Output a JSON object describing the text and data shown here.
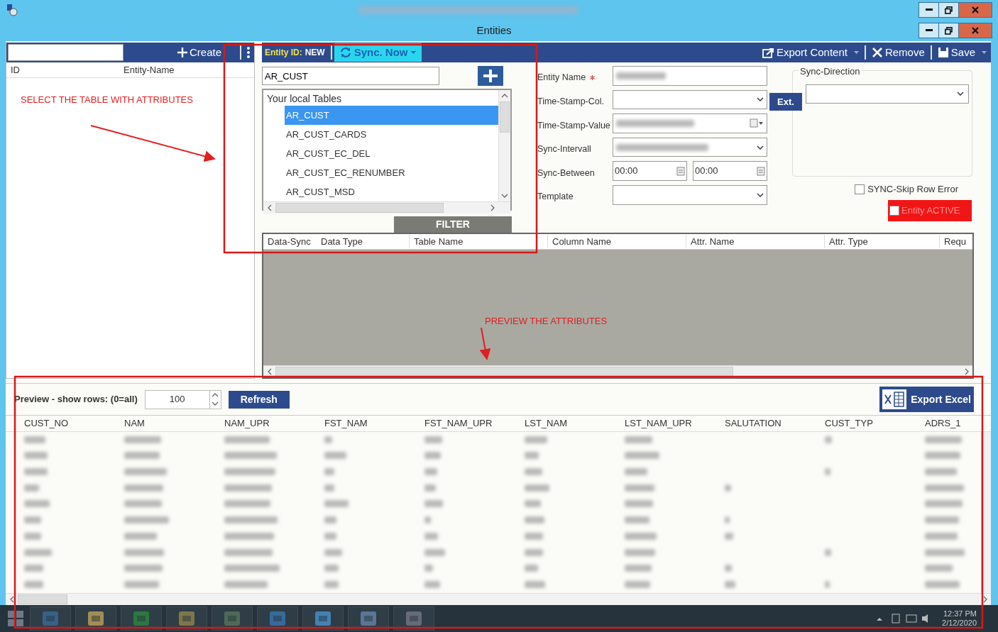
{
  "window": {
    "title": "Entities"
  },
  "entity_list": {
    "create_label": "Create",
    "columns": [
      "ID",
      "Entity-Name"
    ]
  },
  "toolbar": {
    "entity_id_label": "Entity ID:",
    "entity_id": "NEW",
    "sync_label": "Sync. Now",
    "actions": [
      {
        "label": "Export Content",
        "kind": "export",
        "dropdown": true
      },
      {
        "label": "Remove",
        "kind": "remove",
        "dropdown": false
      },
      {
        "label": "Save",
        "kind": "save",
        "dropdown": true
      }
    ]
  },
  "table_picker": {
    "value": "AR_CUST",
    "group": "Your local Tables",
    "filter": "FILTER",
    "tables": [
      {
        "label": "AR_CUST",
        "selected": true
      },
      {
        "label": "AR_CUST_CARDS",
        "selected": false
      },
      {
        "label": "AR_CUST_EC_DEL",
        "selected": false
      },
      {
        "label": "AR_CUST_EC_RENUMBER",
        "selected": false
      },
      {
        "label": "AR_CUST_MSD",
        "selected": false
      }
    ]
  },
  "form": {
    "fields": [
      {
        "label": "Entity Name",
        "kind": "text",
        "required": true,
        "redacted": true
      },
      {
        "label": "Time-Stamp-Col.",
        "kind": "select",
        "required": false,
        "redacted": false
      },
      {
        "label": "Time-Stamp-Value",
        "kind": "date",
        "required": false,
        "redacted": true
      },
      {
        "label": "Sync-Intervall",
        "kind": "select",
        "required": false,
        "redacted": true
      },
      {
        "label": "Sync-Between",
        "kind": "time-pair",
        "required": false,
        "values": [
          "00:00",
          "00:00"
        ]
      },
      {
        "label": "Template",
        "kind": "select",
        "required": false,
        "redacted": false
      }
    ],
    "ext_button": "Ext.",
    "sync_direction": {
      "label": "Sync-Direction"
    },
    "skip_row_error": {
      "label": "SYNC-Skip Row Error",
      "checked": false
    },
    "entity_active": {
      "label": "Entity ACTIVE",
      "checked": false
    }
  },
  "attributes_grid": {
    "columns": [
      "Data-Sync",
      "Data Type",
      "Table Name",
      "Column Name",
      "Attr. Name",
      "Attr. Type",
      "Requ"
    ]
  },
  "preview": {
    "label": "Preview - show rows: (0=all)",
    "rows_value": "100",
    "refresh": "Refresh",
    "export": "Export Excel",
    "columns": [
      "CUST_NO",
      "NAM",
      "NAM_UPR",
      "FST_NAM",
      "FST_NAM_UPR",
      "LST_NAM",
      "LST_NAM_UPR",
      "SALUTATION",
      "CUST_TYP",
      "ADRS_1"
    ]
  },
  "annotations": [
    {
      "text": "SELECT THE TABLE WITH ATTRIBUTES"
    },
    {
      "text": "PREVIEW THE ATTRIBUTES"
    }
  ],
  "taskbar": {
    "time": "12:37 PM",
    "date": "2/12/2020"
  }
}
